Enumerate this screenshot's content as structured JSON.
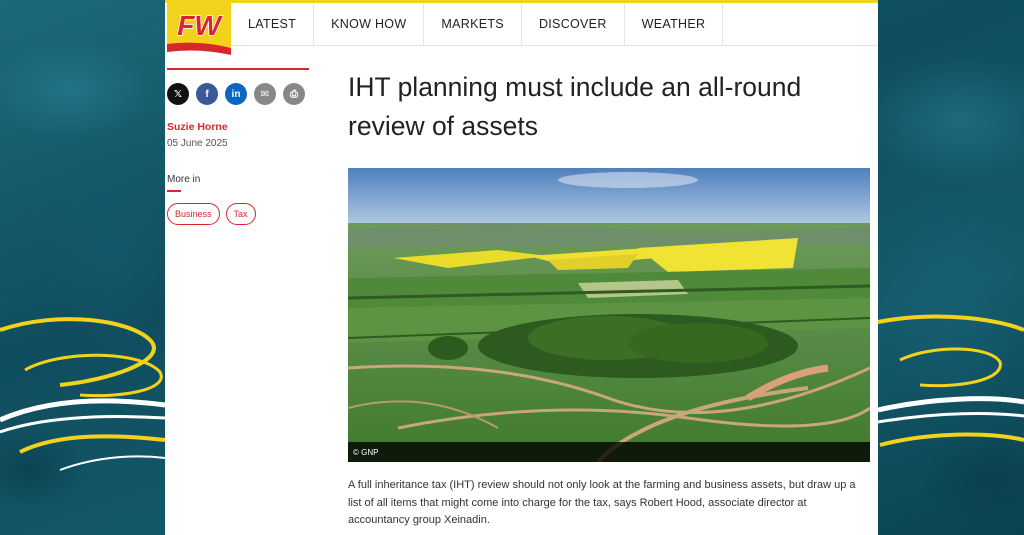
{
  "brand": {
    "logo_text": "FW",
    "accent": "#d8262d",
    "highlight": "#f2d21b"
  },
  "nav": {
    "items": [
      "LATEST",
      "KNOW HOW",
      "MARKETS",
      "DISCOVER",
      "WEATHER"
    ]
  },
  "share": {
    "buttons": [
      {
        "icon": "x-icon",
        "glyph": "𝕏",
        "color": "#111111"
      },
      {
        "icon": "facebook-icon",
        "glyph": "f",
        "color": "#3b5998"
      },
      {
        "icon": "linkedin-icon",
        "glyph": "in",
        "color": "#0a66c2"
      },
      {
        "icon": "email-icon",
        "glyph": "✉",
        "color": "#888888"
      },
      {
        "icon": "print-icon",
        "glyph": "⎙",
        "color": "#888888"
      }
    ]
  },
  "article": {
    "author": "Suzie Horne",
    "date": "05 June 2025",
    "more_in_label": "More in",
    "tags": [
      "Business",
      "Tax"
    ],
    "title": "IHT planning must include an all-round review of assets",
    "image_credit": "© GNP",
    "intro": "A full inheritance tax (IHT) review should not only look at the farming and business assets, but draw up a list of all items that might come into charge for the tax, says Robert Hood, associate director at accountancy group Xeinadin."
  }
}
